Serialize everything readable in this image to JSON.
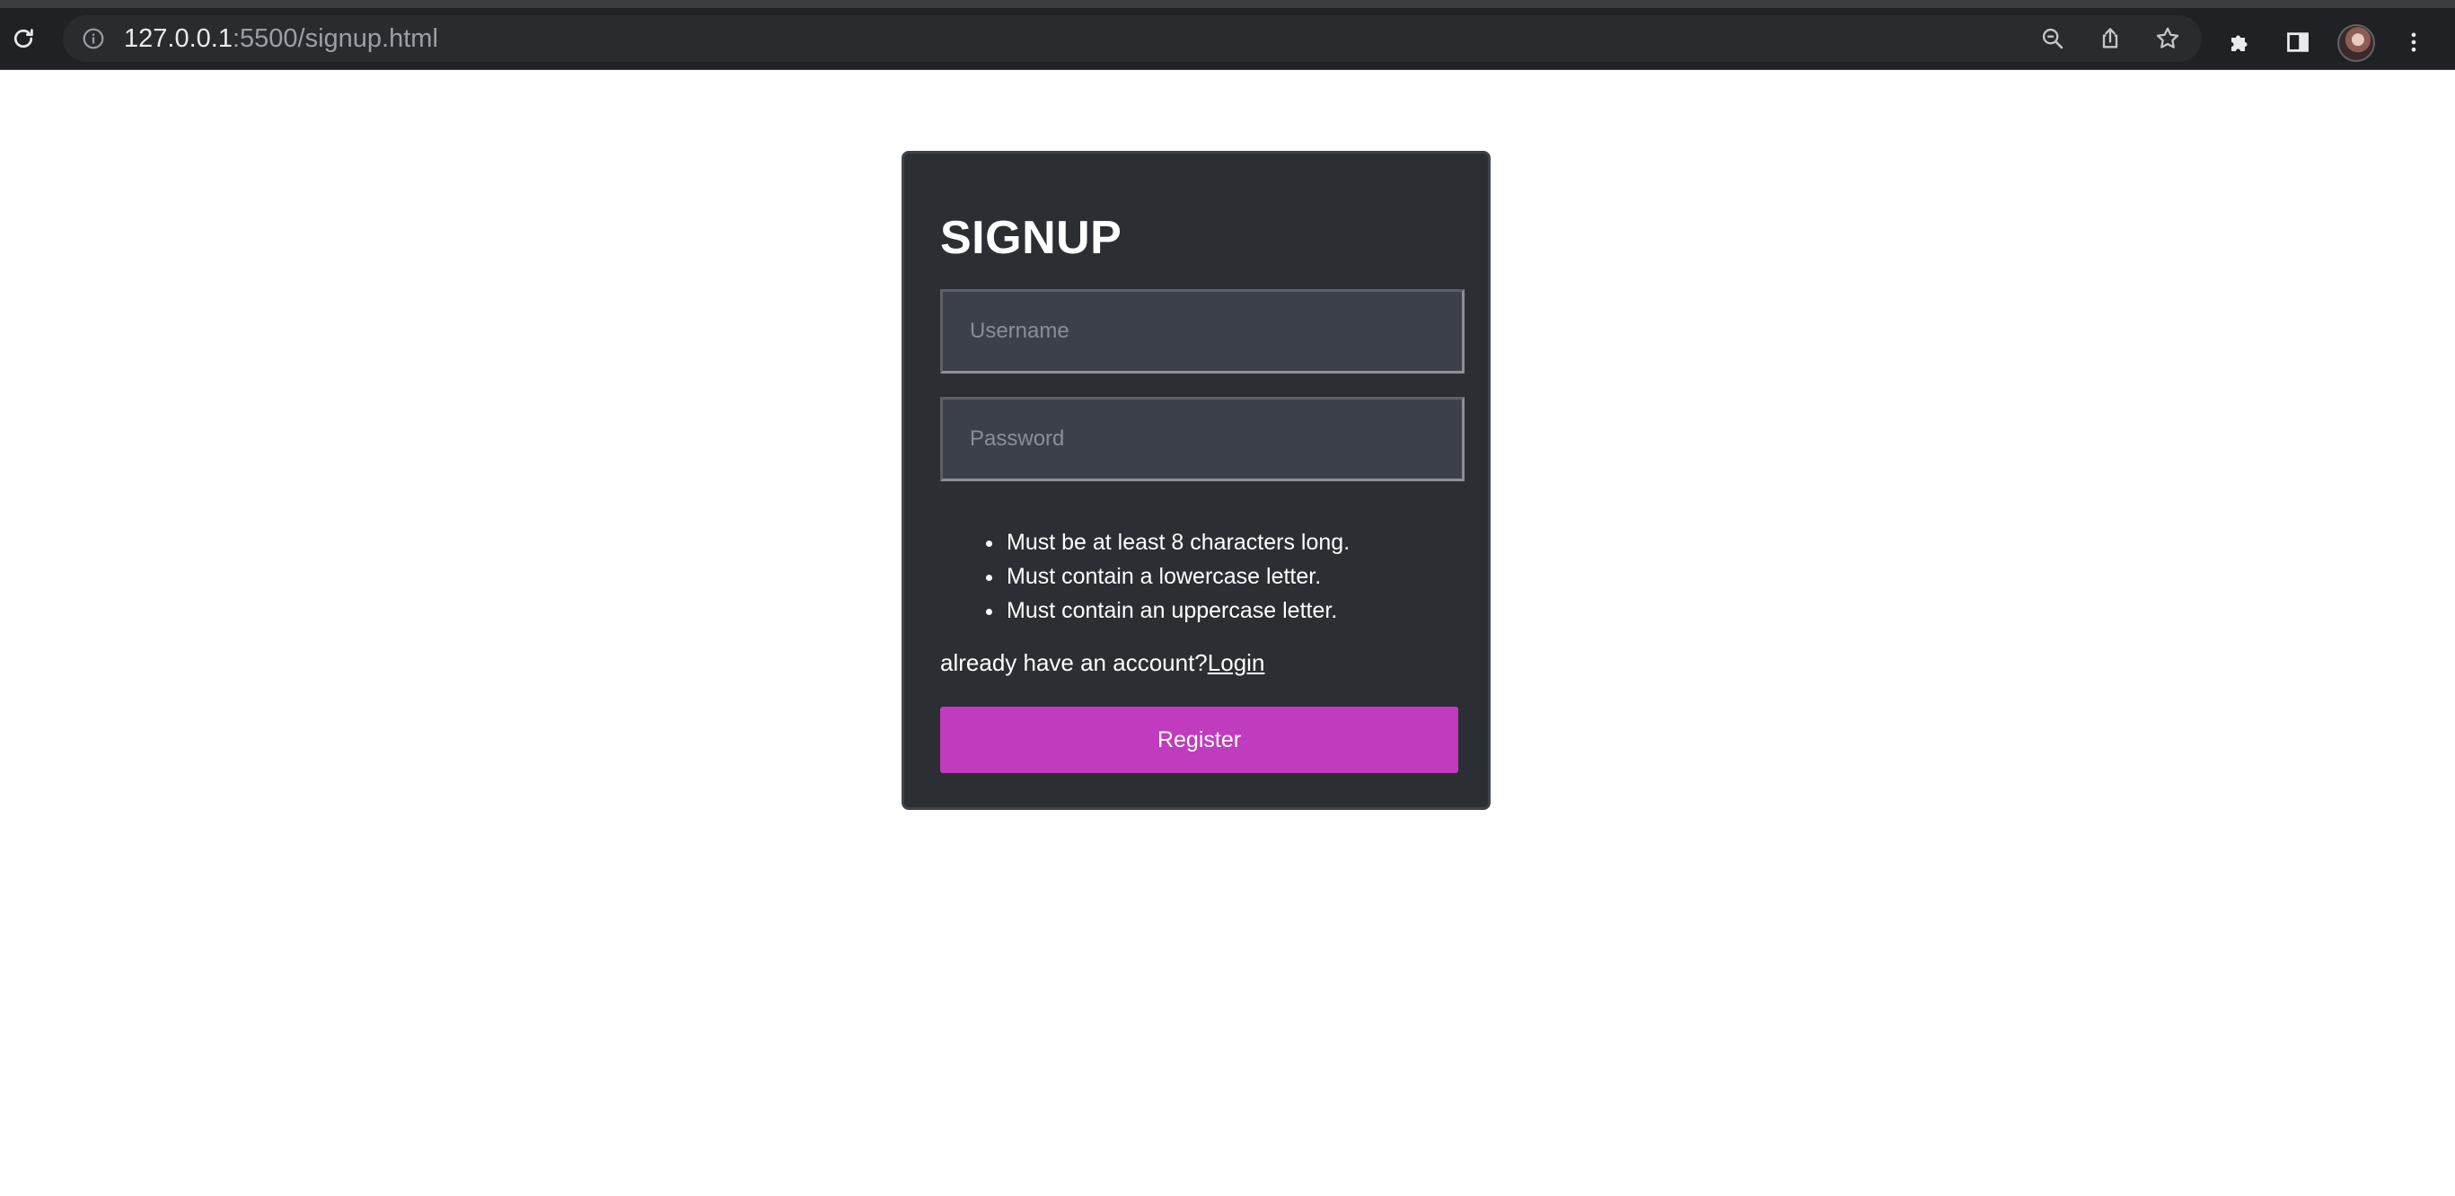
{
  "browser": {
    "url_host": "127.0.0.1",
    "url_path": ":5500/signup.html"
  },
  "icons": {
    "reload": "reload-icon",
    "site_info": "info-icon",
    "zoom": "zoom-out-icon",
    "share": "share-icon",
    "bookmark": "star-icon",
    "extensions": "puzzle-icon",
    "side_panel": "side-panel-icon",
    "profile": "avatar",
    "menu": "kebab-menu-icon"
  },
  "signup": {
    "title": "SIGNUP",
    "username_placeholder": "Username",
    "password_placeholder": "Password",
    "rules": [
      "Must be at least 8 characters long.",
      "Must contain a lowercase letter.",
      "Must contain an uppercase letter."
    ],
    "account_prompt": "already have an account?",
    "login_link": "Login",
    "register_label": "Register"
  },
  "colors": {
    "card_bg": "#2b2e33",
    "input_bg": "#3c4049",
    "register_bg": "#c13bbe",
    "chrome_bg": "#202124"
  }
}
